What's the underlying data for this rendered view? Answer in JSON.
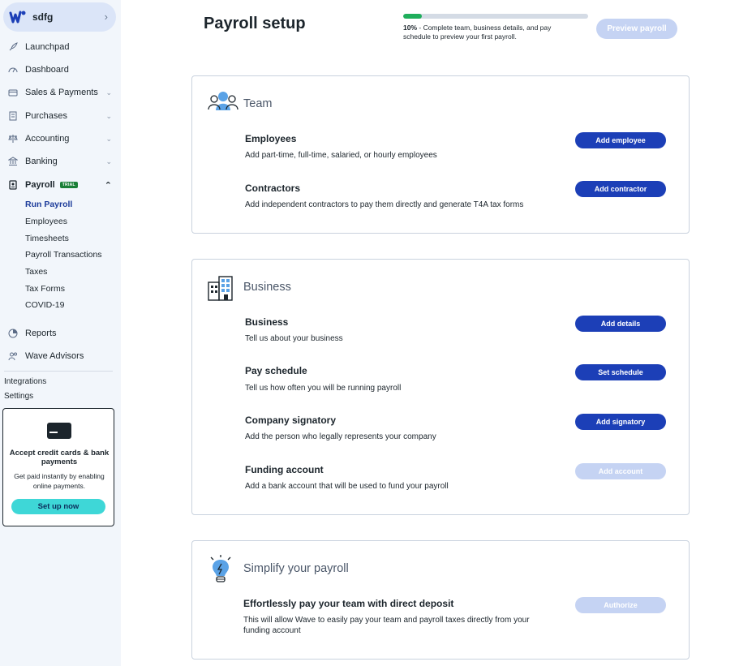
{
  "sidebar": {
    "business_name": "sdfg",
    "items": [
      {
        "label": "Launchpad",
        "icon": "rocket-icon"
      },
      {
        "label": "Dashboard",
        "icon": "dashboard-icon"
      },
      {
        "label": "Sales & Payments",
        "icon": "sales-icon"
      },
      {
        "label": "Purchases",
        "icon": "receipt-icon"
      },
      {
        "label": "Accounting",
        "icon": "scale-icon"
      },
      {
        "label": "Banking",
        "icon": "bank-icon"
      },
      {
        "label": "Payroll",
        "icon": "payroll-icon",
        "badge": "TRIAL"
      },
      {
        "label": "Reports",
        "icon": "reports-icon"
      },
      {
        "label": "Wave Advisors",
        "icon": "advisors-icon"
      }
    ],
    "payroll_sub": [
      "Run Payroll",
      "Employees",
      "Timesheets",
      "Payroll Transactions",
      "Taxes",
      "Tax Forms",
      "COVID-19"
    ],
    "integrations": "Integrations",
    "settings": "Settings",
    "promo": {
      "title": "Accept credit cards & bank payments",
      "desc": "Get paid instantly by enabling online payments.",
      "button": "Set up now"
    }
  },
  "header": {
    "title": "Payroll setup",
    "progress_percent": 10,
    "progress_label": "10%",
    "progress_text": " - Complete team, business details, and pay schedule to preview your first payroll.",
    "preview_button": "Preview payroll"
  },
  "team": {
    "title": "Team",
    "rows": [
      {
        "title": "Employees",
        "desc": "Add part-time, full-time, salaried, or hourly employees",
        "button": "Add employee"
      },
      {
        "title": "Contractors",
        "desc": "Add independent contractors to pay them directly and generate T4A tax forms",
        "button": "Add contractor"
      }
    ]
  },
  "business": {
    "title": "Business",
    "rows": [
      {
        "title": "Business",
        "desc": "Tell us about your business",
        "button": "Add details"
      },
      {
        "title": "Pay schedule",
        "desc": "Tell us how often you will be running payroll",
        "button": "Set schedule"
      },
      {
        "title": "Company signatory",
        "desc": "Add the person who legally represents your company",
        "button": "Add signatory"
      },
      {
        "title": "Funding account",
        "desc": "Add a bank account that will be used to fund your payroll",
        "button": "Add account"
      }
    ]
  },
  "simplify": {
    "title": "Simplify your payroll",
    "rows": [
      {
        "title": "Effortlessly pay your team with direct deposit",
        "desc": "This will allow Wave to easily pay your team and payroll taxes directly from your funding account",
        "button": "Authorize"
      }
    ]
  },
  "colors": {
    "primary": "#1c3fb7",
    "disabled": "#c5d3f3",
    "progress": "#1fae5b",
    "sidebar": "#f2f6fb"
  }
}
